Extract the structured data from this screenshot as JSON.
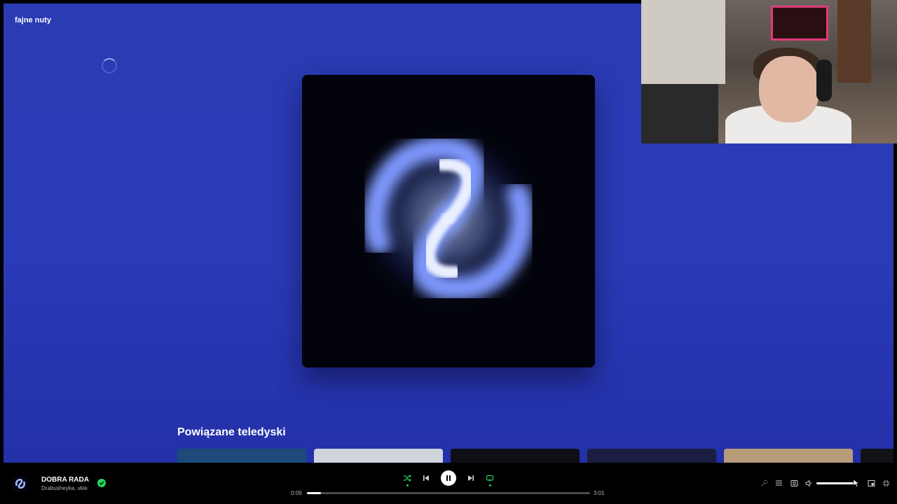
{
  "playlist": {
    "title": "fajne nuty"
  },
  "related": {
    "title": "Powiązane teledyski",
    "thumb_colors": [
      "#1d4a7a",
      "#cfd4dc",
      "#0e0f14",
      "#1b1e40",
      "#b79c7a",
      "#121216"
    ]
  },
  "now_playing": {
    "title": "DOBRA RADA",
    "artist": "Drabusheyka, vkie",
    "liked": true
  },
  "player": {
    "elapsed": "0:09",
    "duration": "3:01",
    "progress_fraction": 0.05,
    "volume_fraction": 0.95,
    "shuffle_on": true,
    "repeat_on": true,
    "playing": true
  },
  "icons": {
    "shuffle": "shuffle-icon",
    "previous": "skip-previous-icon",
    "pause": "pause-icon",
    "next": "skip-next-icon",
    "repeat": "repeat-icon",
    "lyrics": "microphone-icon",
    "queue": "queue-icon",
    "devices": "connect-device-icon",
    "volume": "speaker-icon",
    "miniplayer": "miniplayer-icon",
    "exit_fullscreen": "exit-fullscreen-icon"
  },
  "colors": {
    "background": "#2a3bb3",
    "accent": "#1ed760"
  }
}
